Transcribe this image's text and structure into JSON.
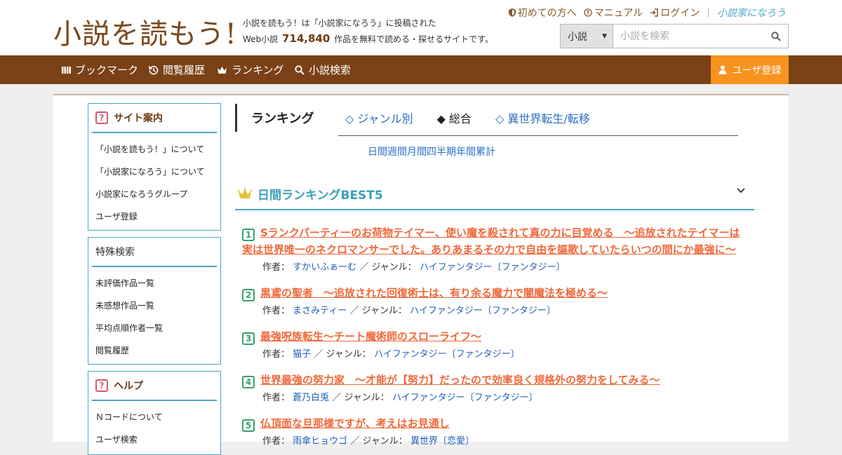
{
  "header": {
    "logo_text": "小説を読もう!",
    "tagline_line1": "小説を読もう！は「小説家になろう」に投稿された",
    "tagline_prefix": "Web小説",
    "novel_count": "714,840",
    "tagline_suffix": "作品を無料で読める・探せるサイトです。",
    "topnav": {
      "first_time": "初めての方へ",
      "manual": "マニュアル",
      "login": "ログイン",
      "narou_logo": "小説家になろう"
    },
    "search": {
      "category": "小説",
      "placeholder": "小説を検索"
    }
  },
  "navbar": {
    "bookmark": "ブックマーク",
    "history": "閲覧履歴",
    "ranking": "ランキング",
    "search": "小説検索",
    "register": "ユーザ登録"
  },
  "sidebar": {
    "site_info": {
      "title": "サイト案内",
      "items": [
        "「小説を読もう！」について",
        "「小説家になろう」について",
        "小説家になろうグループ",
        "ユーザ登録"
      ]
    },
    "special_search": {
      "title": "特殊検索",
      "items": [
        "未評価作品一覧",
        "未感想作品一覧",
        "平均点順作者一覧",
        "閲覧履歴"
      ]
    },
    "help": {
      "title": "ヘルプ",
      "items": [
        "Ｎコードについて",
        "ユーザ検索"
      ]
    }
  },
  "ranking": {
    "heading": "ランキング",
    "tabs": [
      "◇ ジャンル別",
      "◆ 総合",
      "◇ 異世界転生/転移"
    ],
    "periods": [
      "日間",
      "週間",
      "月間",
      "四半期",
      "年間",
      "累計"
    ],
    "best_title": "日間ランキングBEST5",
    "author_label": "作者：",
    "genre_label": "／ ジャンル：",
    "entries": [
      {
        "rank": "1",
        "title": "Sランクパーティーのお荷物テイマー、使い魔を殺されて真の力に目覚める　〜追放されたテイマーは実は世界唯一のネクロマンサーでした。ありあまるその力で自由を謳歌していたらいつの間にか最強に〜",
        "author": "すかいふぁーむ",
        "genre": "ハイファンタジー〔ファンタジー〕"
      },
      {
        "rank": "2",
        "title": "黒鳶の聖者　〜追放された回復術士は、有り余る魔力で闇魔法を極める〜",
        "author": "まさみティー",
        "genre": "ハイファンタジー〔ファンタジー〕"
      },
      {
        "rank": "3",
        "title": "最強呪族転生～チート魔術師のスローライフ～",
        "author": "猫子",
        "genre": "ハイファンタジー〔ファンタジー〕"
      },
      {
        "rank": "4",
        "title": "世界最強の努力家　〜才能が【努力】だったので効率良く規格外の努力をしてみる〜",
        "author": "蒼乃白兎",
        "genre": "ハイファンタジー〔ファンタジー〕"
      },
      {
        "rank": "5",
        "title": "仏頂面な旦那様ですが、考えはお見通し",
        "author": "雨傘ヒョウゴ",
        "genre": "異世界〔恋愛〕"
      }
    ]
  }
}
